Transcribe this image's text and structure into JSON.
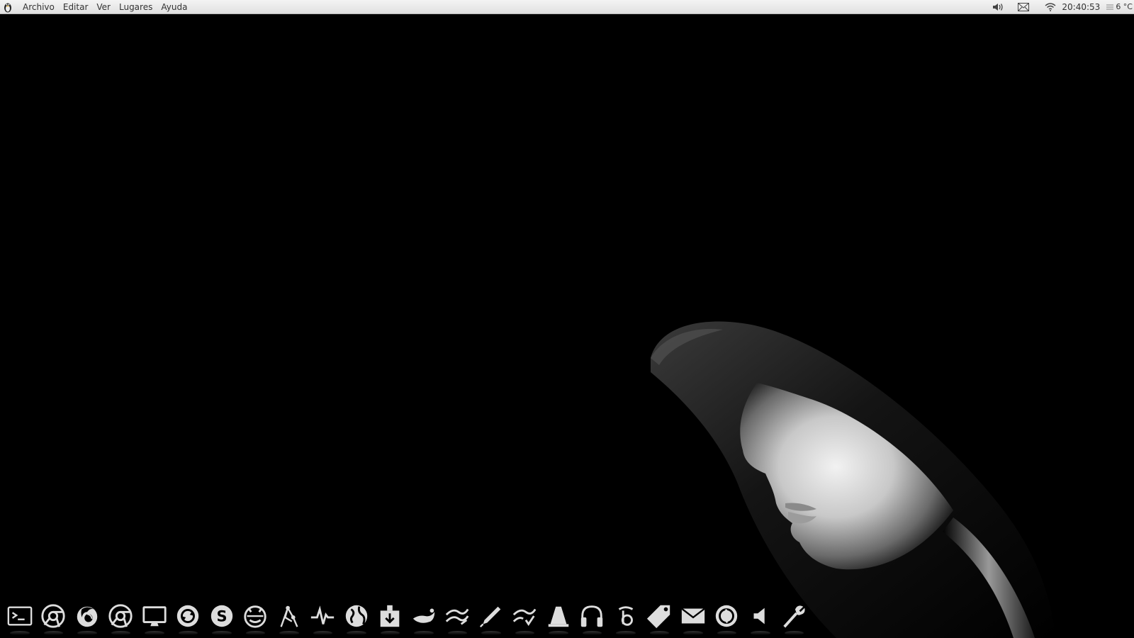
{
  "top_panel": {
    "menus": [
      "Archivo",
      "Editar",
      "Ver",
      "Lugares",
      "Ayuda"
    ],
    "clock": "20:40:53",
    "weather": "6 °C",
    "tray_icons": [
      "volume-icon",
      "mail-icon",
      "wifi-icon"
    ]
  },
  "dock": {
    "items": [
      "terminal-icon",
      "chromium-icon",
      "firefox-icon",
      "chrome-icon",
      "monitor-icon",
      "update-manager-icon",
      "skype-icon",
      "pidgin-icon",
      "network-tool-icon",
      "system-monitor-icon",
      "globe-icon",
      "installer-icon",
      "gimp-icon",
      "writer-icon",
      "pen-icon",
      "office-icon",
      "vlc-icon",
      "headphones-icon",
      "bittorrent-icon",
      "tag-icon",
      "mail-icon",
      "recovery-icon",
      "speaker-icon",
      "settings-icon"
    ]
  },
  "colors": {
    "panel_bg": "#e6e6e6",
    "desktop_bg": "#000000",
    "dock_icon": "#d8d8d8"
  }
}
